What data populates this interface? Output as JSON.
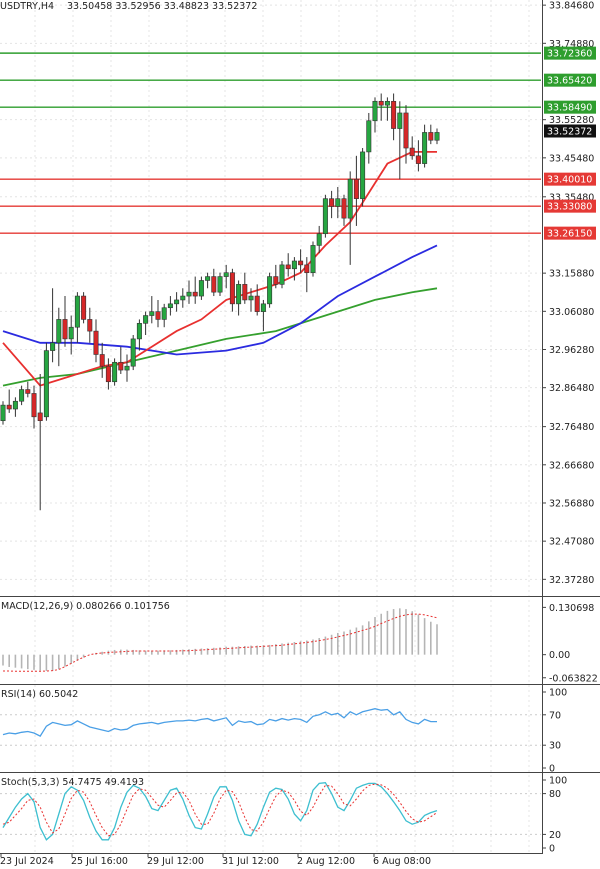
{
  "header": {
    "symbol": "USDTRY,H4",
    "ohlc": "33.50458 33.52956 33.48823 33.52372"
  },
  "colors": {
    "bull": "#26a641",
    "bear": "#d62728",
    "support": "#e53935",
    "resistance": "#2e9e2e",
    "ma_fast": "#e8302f",
    "ma_mid": "#2b2be0",
    "ma_slow": "#35a02e",
    "macd_hist": "#b5b5b5",
    "macd_signal": "#e8302f",
    "rsi": "#4a9fe6",
    "stoch_main": "#3dbfd0",
    "stoch_signal": "#e8302f",
    "grid": "#e4e4e4"
  },
  "chart_data": {
    "type": "candlestick",
    "price_axis": {
      "ylim": [
        32.33,
        33.86
      ],
      "ticks": [
        "33.84680",
        "33.74880",
        "33.55280",
        "33.45480",
        "33.35480",
        "33.15880",
        "33.06080",
        "32.96280",
        "32.86480",
        "32.76480",
        "32.66680",
        "32.56880",
        "32.47080",
        "32.37280"
      ]
    },
    "current_price": "33.52372",
    "resistance_levels": [
      {
        "value": 33.7236,
        "label": "33.72360"
      },
      {
        "value": 33.6542,
        "label": "33.65420"
      },
      {
        "value": 33.5849,
        "label": "33.58490"
      }
    ],
    "support_levels": [
      {
        "value": 33.4001,
        "label": "33.40010"
      },
      {
        "value": 33.3308,
        "label": "33.33080"
      },
      {
        "value": 33.2615,
        "label": "33.26150"
      }
    ],
    "x_labels": [
      "23 Jul 2024",
      "25 Jul 16:00",
      "29 Jul 12:00",
      "31 Jul 12:00",
      "2 Aug 12:00",
      "6 Aug 08:00"
    ],
    "candles": [
      [
        32.78,
        32.83,
        32.77,
        32.82
      ],
      [
        32.82,
        32.86,
        32.8,
        32.81
      ],
      [
        32.81,
        32.84,
        32.79,
        32.83
      ],
      [
        32.83,
        32.87,
        32.82,
        32.86
      ],
      [
        32.86,
        32.88,
        32.84,
        32.85
      ],
      [
        32.85,
        32.87,
        32.76,
        32.79
      ],
      [
        32.8,
        32.9,
        32.55,
        32.78
      ],
      [
        32.79,
        32.98,
        32.78,
        32.96
      ],
      [
        32.96,
        33.12,
        32.93,
        32.98
      ],
      [
        32.98,
        33.07,
        32.92,
        33.04
      ],
      [
        33.04,
        33.1,
        32.97,
        32.99
      ],
      [
        32.99,
        33.05,
        32.95,
        33.02
      ],
      [
        33.02,
        33.11,
        32.98,
        33.1
      ],
      [
        33.1,
        33.11,
        33.03,
        33.04
      ],
      [
        33.04,
        33.07,
        32.98,
        33.01
      ],
      [
        33.01,
        33.04,
        32.93,
        32.95
      ],
      [
        32.95,
        32.98,
        32.89,
        32.92
      ],
      [
        32.92,
        32.94,
        32.86,
        32.88
      ],
      [
        32.88,
        32.94,
        32.87,
        32.93
      ],
      [
        32.93,
        32.97,
        32.9,
        32.91
      ],
      [
        32.91,
        32.95,
        32.88,
        32.92
      ],
      [
        32.92,
        33.0,
        32.91,
        32.99
      ],
      [
        32.99,
        33.04,
        32.96,
        33.03
      ],
      [
        33.03,
        33.06,
        33.0,
        33.05
      ],
      [
        33.05,
        33.1,
        33.03,
        33.06
      ],
      [
        33.06,
        33.09,
        33.02,
        33.04
      ],
      [
        33.04,
        33.08,
        33.02,
        33.07
      ],
      [
        33.07,
        33.1,
        33.05,
        33.08
      ],
      [
        33.08,
        33.11,
        33.06,
        33.09
      ],
      [
        33.09,
        33.12,
        33.07,
        33.1
      ],
      [
        33.1,
        33.14,
        33.08,
        33.11
      ],
      [
        33.11,
        33.15,
        33.08,
        33.1
      ],
      [
        33.1,
        33.15,
        33.09,
        33.14
      ],
      [
        33.14,
        33.16,
        33.12,
        33.15
      ],
      [
        33.15,
        33.17,
        33.1,
        33.11
      ],
      [
        33.11,
        33.16,
        33.1,
        33.15
      ],
      [
        33.15,
        33.18,
        33.12,
        33.16
      ],
      [
        33.16,
        33.17,
        33.06,
        33.08
      ],
      [
        33.08,
        33.14,
        33.05,
        33.13
      ],
      [
        33.13,
        33.16,
        33.08,
        33.09
      ],
      [
        33.09,
        33.12,
        33.06,
        33.1
      ],
      [
        33.1,
        33.13,
        33.05,
        33.06
      ],
      [
        33.06,
        33.09,
        33.01,
        33.08
      ],
      [
        33.08,
        33.16,
        33.07,
        33.15
      ],
      [
        33.15,
        33.18,
        33.12,
        33.13
      ],
      [
        33.13,
        33.19,
        33.12,
        33.18
      ],
      [
        33.18,
        33.21,
        33.15,
        33.17
      ],
      [
        33.17,
        33.2,
        33.14,
        33.19
      ],
      [
        33.19,
        33.22,
        33.16,
        33.18
      ],
      [
        33.18,
        33.2,
        33.11,
        33.16
      ],
      [
        33.16,
        33.24,
        33.15,
        33.23
      ],
      [
        33.23,
        33.28,
        33.21,
        33.26
      ],
      [
        33.26,
        33.36,
        33.25,
        33.35
      ],
      [
        33.35,
        33.37,
        33.3,
        33.33
      ],
      [
        33.33,
        33.38,
        33.3,
        33.35
      ],
      [
        33.35,
        33.36,
        33.28,
        33.3
      ],
      [
        33.3,
        33.42,
        33.18,
        33.4
      ],
      [
        33.4,
        33.46,
        33.28,
        33.35
      ],
      [
        33.35,
        33.48,
        33.33,
        33.47
      ],
      [
        33.47,
        33.57,
        33.44,
        33.55
      ],
      [
        33.55,
        33.61,
        33.52,
        33.6
      ],
      [
        33.6,
        33.62,
        33.55,
        33.59
      ],
      [
        33.59,
        33.61,
        33.55,
        33.6
      ],
      [
        33.6,
        33.62,
        33.5,
        33.53
      ],
      [
        33.53,
        33.6,
        33.4,
        33.57
      ],
      [
        33.57,
        33.59,
        33.44,
        33.48
      ],
      [
        33.48,
        33.51,
        33.45,
        33.46
      ],
      [
        33.46,
        33.5,
        33.42,
        33.44
      ],
      [
        33.44,
        33.54,
        33.43,
        33.52
      ],
      [
        33.52,
        33.54,
        33.49,
        33.5
      ],
      [
        33.5,
        33.53,
        33.49,
        33.52
      ]
    ],
    "ma_fast": [
      [
        0,
        32.98
      ],
      [
        6,
        32.87
      ],
      [
        10,
        32.89
      ],
      [
        16,
        32.92
      ],
      [
        20,
        32.93
      ],
      [
        24,
        32.97
      ],
      [
        28,
        33.01
      ],
      [
        32,
        33.04
      ],
      [
        36,
        33.09
      ],
      [
        40,
        33.11
      ],
      [
        44,
        33.13
      ],
      [
        48,
        33.16
      ],
      [
        52,
        33.23
      ],
      [
        56,
        33.29
      ],
      [
        58,
        33.34
      ],
      [
        62,
        33.44
      ],
      [
        66,
        33.47
      ],
      [
        70,
        33.47
      ]
    ],
    "ma_mid": [
      [
        0,
        33.01
      ],
      [
        6,
        32.98
      ],
      [
        12,
        32.98
      ],
      [
        20,
        32.97
      ],
      [
        28,
        32.95
      ],
      [
        36,
        32.96
      ],
      [
        42,
        32.98
      ],
      [
        48,
        33.03
      ],
      [
        54,
        33.1
      ],
      [
        60,
        33.15
      ],
      [
        66,
        33.2
      ],
      [
        70,
        33.23
      ]
    ],
    "ma_slow": [
      [
        0,
        32.87
      ],
      [
        6,
        32.89
      ],
      [
        12,
        32.9
      ],
      [
        20,
        32.93
      ],
      [
        28,
        32.96
      ],
      [
        36,
        32.99
      ],
      [
        44,
        33.01
      ],
      [
        52,
        33.05
      ],
      [
        60,
        33.09
      ],
      [
        66,
        33.11
      ],
      [
        70,
        33.12
      ]
    ],
    "macd": {
      "label": "MACD(12,26,9) 0.080266 0.101756",
      "ticks": [
        "0.130698",
        "0.00",
        "-0.063822"
      ],
      "ylim": [
        -0.07,
        0.14
      ],
      "hist": [
        -0.03,
        -0.034,
        -0.036,
        -0.038,
        -0.04,
        -0.042,
        -0.044,
        -0.045,
        -0.045,
        -0.04,
        -0.033,
        -0.025,
        -0.017,
        -0.008,
        0.0,
        0.005,
        0.008,
        0.011,
        0.013,
        0.014,
        0.014,
        0.013,
        0.012,
        0.011,
        0.011,
        0.011,
        0.012,
        0.012,
        0.013,
        0.014,
        0.015,
        0.016,
        0.017,
        0.018,
        0.019,
        0.02,
        0.022,
        0.022,
        0.023,
        0.024,
        0.025,
        0.025,
        0.026,
        0.027,
        0.029,
        0.031,
        0.033,
        0.035,
        0.037,
        0.039,
        0.042,
        0.046,
        0.05,
        0.055,
        0.06,
        0.064,
        0.069,
        0.075,
        0.081,
        0.092,
        0.104,
        0.113,
        0.121,
        0.126,
        0.128,
        0.126,
        0.12,
        0.111,
        0.101,
        0.091,
        0.084
      ],
      "signal": [
        -0.045,
        -0.045,
        -0.046,
        -0.046,
        -0.046,
        -0.046,
        -0.046,
        -0.045,
        -0.044,
        -0.041,
        -0.033,
        -0.024,
        -0.015,
        -0.007,
        0.0,
        0.003,
        0.005,
        0.006,
        0.007,
        0.008,
        0.009,
        0.01,
        0.01,
        0.01,
        0.01,
        0.01,
        0.01,
        0.01,
        0.01,
        0.011,
        0.011,
        0.012,
        0.013,
        0.014,
        0.015,
        0.016,
        0.017,
        0.018,
        0.019,
        0.02,
        0.021,
        0.022,
        0.023,
        0.024,
        0.025,
        0.026,
        0.028,
        0.03,
        0.032,
        0.034,
        0.036,
        0.039,
        0.042,
        0.045,
        0.049,
        0.053,
        0.057,
        0.062,
        0.067,
        0.072,
        0.078,
        0.086,
        0.093,
        0.1,
        0.106,
        0.11,
        0.112,
        0.112,
        0.11,
        0.106,
        0.102
      ]
    },
    "rsi": {
      "label": "RSI(14) 60.5042",
      "ticks": [
        "100",
        "70",
        "30",
        "0"
      ],
      "ylim": [
        0,
        100
      ],
      "values": [
        44,
        46,
        45,
        47,
        48,
        46,
        42,
        55,
        60,
        58,
        56,
        57,
        62,
        58,
        54,
        52,
        50,
        48,
        52,
        50,
        51,
        56,
        58,
        59,
        60,
        58,
        60,
        61,
        62,
        62,
        63,
        62,
        64,
        65,
        62,
        64,
        66,
        56,
        62,
        60,
        61,
        57,
        58,
        64,
        62,
        65,
        63,
        65,
        64,
        60,
        68,
        70,
        74,
        70,
        72,
        66,
        74,
        70,
        74,
        76,
        78,
        76,
        77,
        70,
        74,
        64,
        60,
        58,
        64,
        61,
        61
      ]
    },
    "stoch": {
      "label": "Stoch(5,3,3) 54.7475 49.4193",
      "ticks": [
        "100",
        "80",
        "20",
        "0"
      ],
      "ylim": [
        0,
        100
      ],
      "main": [
        30,
        45,
        60,
        72,
        80,
        68,
        30,
        12,
        20,
        50,
        80,
        90,
        85,
        70,
        45,
        25,
        12,
        12,
        30,
        60,
        82,
        92,
        88,
        76,
        58,
        55,
        70,
        85,
        88,
        72,
        48,
        30,
        28,
        50,
        75,
        90,
        90,
        70,
        40,
        20,
        18,
        35,
        60,
        82,
        88,
        86,
        72,
        50,
        40,
        55,
        85,
        95,
        96,
        80,
        60,
        55,
        70,
        88,
        92,
        95,
        95,
        90,
        80,
        68,
        55,
        40,
        35,
        38,
        48,
        52,
        55
      ],
      "signal": [
        35,
        38,
        48,
        58,
        70,
        72,
        60,
        38,
        22,
        28,
        50,
        73,
        85,
        82,
        68,
        48,
        30,
        18,
        20,
        35,
        57,
        78,
        87,
        85,
        74,
        63,
        60,
        70,
        81,
        82,
        70,
        50,
        35,
        35,
        51,
        72,
        85,
        83,
        68,
        45,
        27,
        25,
        38,
        58,
        76,
        85,
        82,
        70,
        54,
        48,
        60,
        78,
        92,
        91,
        80,
        65,
        62,
        72,
        84,
        92,
        94,
        93,
        88,
        79,
        67,
        54,
        43,
        38,
        40,
        46,
        52
      ]
    }
  }
}
